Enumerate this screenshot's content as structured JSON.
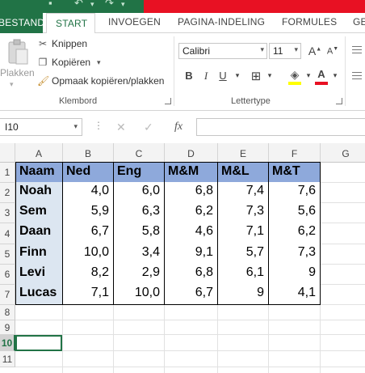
{
  "app": {
    "colors": {
      "excel_green": "#217346",
      "title_red": "#e81123",
      "header_fill": "#8ea9db",
      "name_fill": "#dce6f1"
    }
  },
  "quick_access": {
    "icons": [
      "undo-icon",
      "redo-icon",
      "customize-icon"
    ]
  },
  "ribbon": {
    "tabs": [
      "BESTAND",
      "START",
      "INVOEGEN",
      "PAGINA-INDELING",
      "FORMULES",
      "GE"
    ],
    "active_tab": "START",
    "clipboard": {
      "paste_label": "Plakken",
      "cut_label": "Knippen",
      "copy_label": "Kopiëren",
      "format_painter_label": "Opmaak kopiëren/plakken",
      "group_label": "Klembord"
    },
    "font": {
      "font_name": "Calibri",
      "font_size": "11",
      "bold": "B",
      "italic": "I",
      "underline": "U",
      "grow": "A",
      "shrink": "A",
      "font_color_glyph": "A",
      "group_label": "Lettertype"
    }
  },
  "formula_bar": {
    "name_box": "I10",
    "fx_label": "fx",
    "value": ""
  },
  "grid": {
    "columns": [
      "A",
      "B",
      "C",
      "D",
      "E",
      "F",
      "G"
    ],
    "rows": [
      "1",
      "2",
      "3",
      "4",
      "5",
      "6",
      "7",
      "8",
      "9",
      "10",
      "11"
    ],
    "selected_row": "10",
    "header": [
      "Naam",
      "Ned",
      "Eng",
      "M&M",
      "M&L",
      "M&T"
    ],
    "data": [
      [
        "Noah",
        "4,0",
        "6,0",
        "6,8",
        "7,4",
        "7,6"
      ],
      [
        "Sem",
        "5,9",
        "6,3",
        "6,2",
        "7,3",
        "5,6"
      ],
      [
        "Daan",
        "6,7",
        "5,8",
        "4,6",
        "7,1",
        "6,2"
      ],
      [
        "Finn",
        "10,0",
        "3,4",
        "9,1",
        "5,7",
        "7,3"
      ],
      [
        "Levi",
        "8,2",
        "2,9",
        "6,8",
        "6,1",
        "9"
      ],
      [
        "Lucas",
        "7,1",
        "10,0",
        "6,7",
        "9",
        "4,1"
      ]
    ]
  }
}
